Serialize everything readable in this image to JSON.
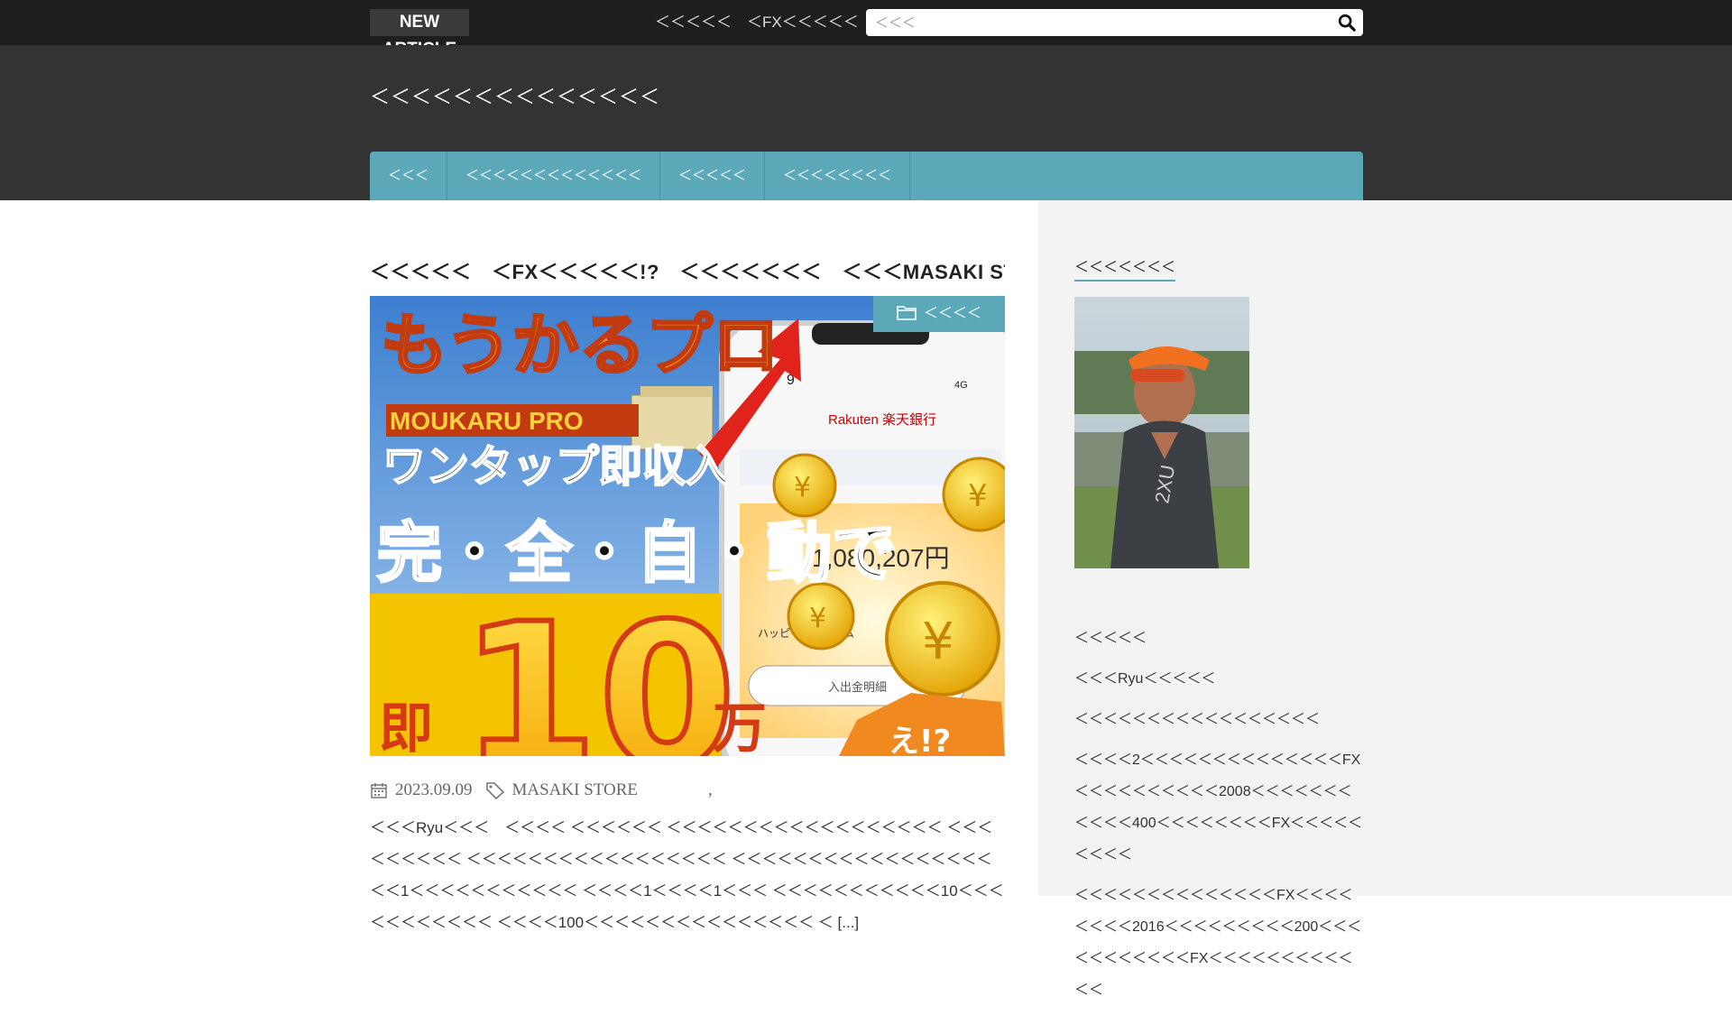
{
  "topbar": {
    "new_article_line1": "NEW",
    "new_article_line2": "ARTICLE",
    "ticker_text": "＜＜＜＜＜　＜FX＜＜＜＜＜!?　＜＜＜＜＜＜",
    "search_placeholder": "＜＜＜"
  },
  "header": {
    "site_title": "＜＜＜＜＜＜＜＜＜＜＜＜＜＜",
    "nav_items": [
      "＜＜＜",
      "＜＜＜＜＜＜＜＜＜＜＜＜＜",
      "＜＜＜＜＜",
      "＜＜＜＜＜＜＜＜"
    ]
  },
  "article": {
    "title": "＜＜＜＜＜　＜FX＜＜＜＜＜!?　＜＜＜＜＜＜＜　＜＜＜MASAKI STORE＜＜＜",
    "category": "＜＜＜＜",
    "date": "2023.09.09",
    "tag": "MASAKI  STORE",
    "tag_separator": ",",
    "excerpt": "＜＜＜Ryu＜＜＜　＜＜＜＜ ＜＜＜＜＜＜ ＜＜＜＜＜＜＜＜＜＜＜＜＜＜＜＜＜＜ ＜＜＜ ＜＜＜＜＜＜ ＜＜＜＜＜＜＜＜＜＜＜＜＜＜＜＜＜ ＜＜＜＜＜＜＜＜＜＜＜＜＜＜＜＜＜＜＜1＜＜＜＜＜＜＜＜＜＜＜ ＜＜＜＜1＜＜＜＜1＜＜＜ ＜＜＜＜＜＜＜＜＜＜＜10＜＜＜＜＜＜＜＜＜＜＜ ＜＜＜＜100＜＜＜＜＜＜＜＜＜＜＜＜＜＜＜ ＜ [...]",
    "image": {
      "logo_text": "もうかるプロ",
      "brand_text": "MOUKARU PRO",
      "tagline": "ワンタップ即収入",
      "headline": "完・全・自・動で",
      "big_number": "10",
      "prefix": "即",
      "suffix": "万",
      "exclaim": "え!?",
      "phone_bank": "Rakuten 楽天銀行",
      "phone_amount": "1,080,207円",
      "phone_time": "9",
      "phone_signal": "4G",
      "phone_button": "入出金明細",
      "phone_row": "ハッピープログラム"
    }
  },
  "sidebar": {
    "heading": "＜＜＜＜＜＜＜",
    "links": [
      "＜＜＜＜＜",
      "＜＜＜Ryu＜＜＜＜＜",
      "＜＜＜＜＜＜＜＜＜＜＜＜＜＜＜＜＜",
      "＜＜＜＜2＜＜＜＜＜＜＜＜＜＜＜＜＜＜FX＜＜＜＜＜＜＜＜＜＜2008＜＜＜＜＜＜＜＜＜＜＜400＜＜＜＜＜＜＜＜FX＜＜＜＜＜＜＜＜＜",
      "＜＜＜＜＜＜＜＜＜＜＜＜＜＜FX＜＜＜＜＜＜＜＜2016＜＜＜＜＜＜＜＜＜200＜＜＜＜＜＜＜＜＜＜＜FX＜＜＜＜＜＜＜＜＜＜＜＜"
    ]
  }
}
